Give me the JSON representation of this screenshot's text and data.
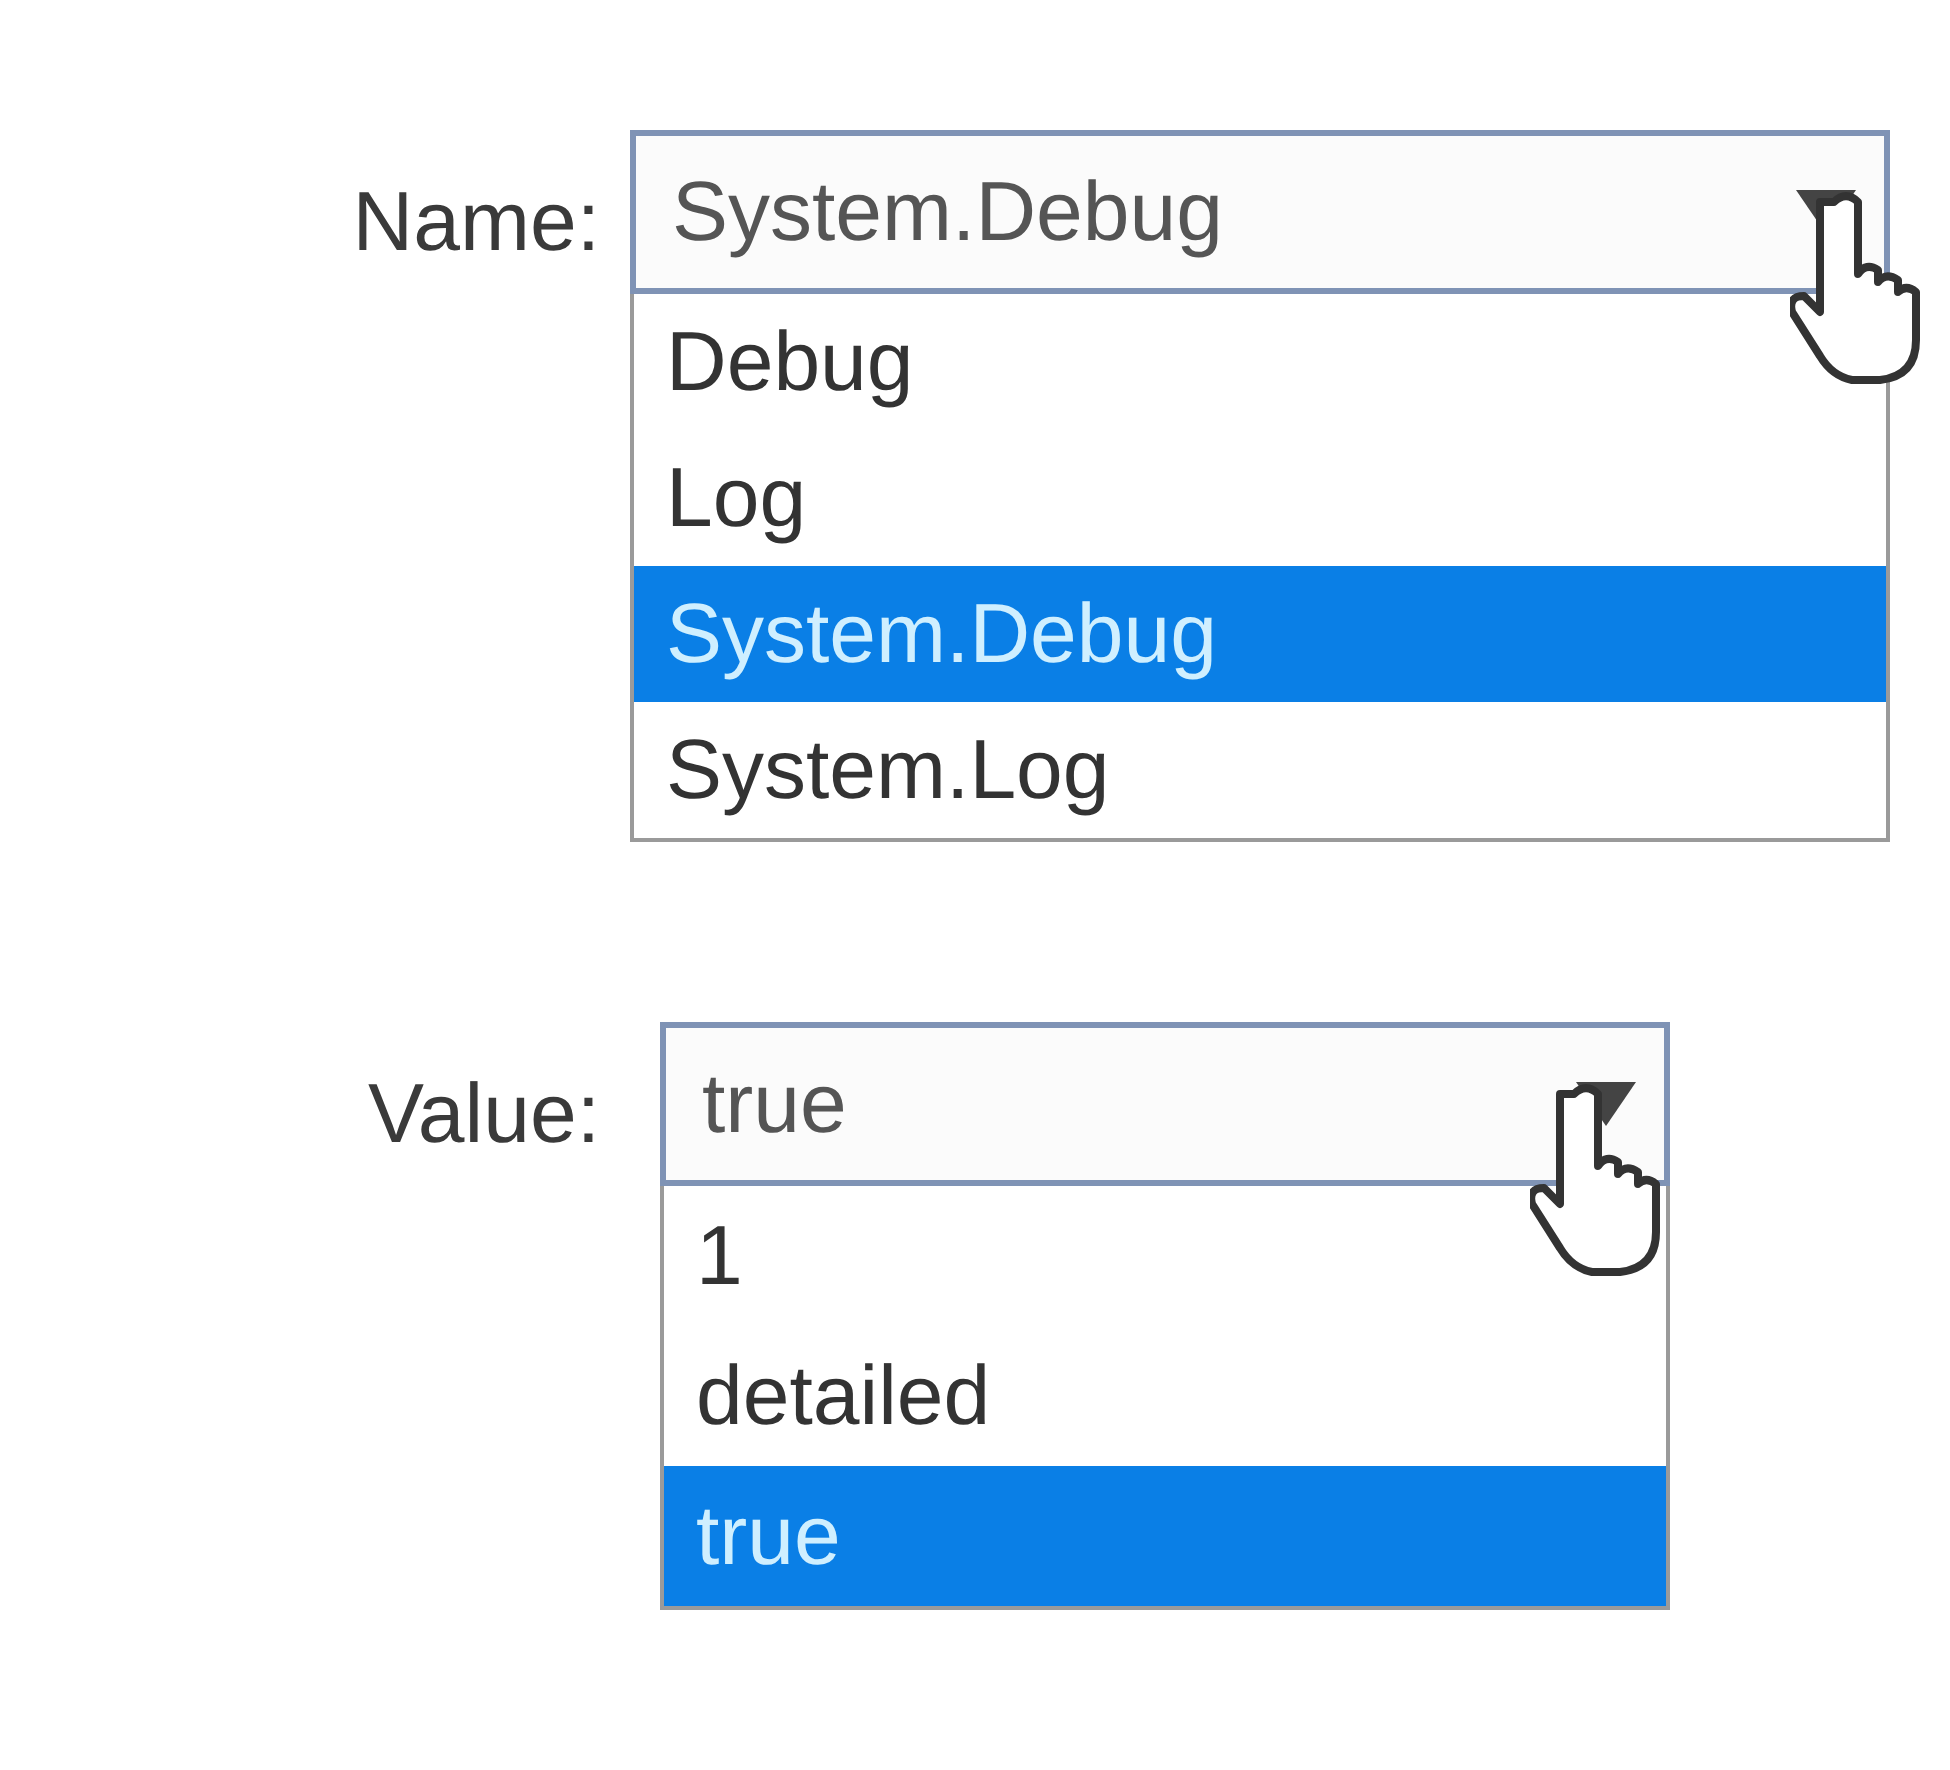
{
  "fields": [
    {
      "label": "Name:",
      "value": "System.Debug",
      "open": true,
      "options": [
        {
          "label": "Debug",
          "selected": false
        },
        {
          "label": "Log",
          "selected": false
        },
        {
          "label": "System.Debug",
          "selected": true
        },
        {
          "label": "System.Log",
          "selected": false
        }
      ]
    },
    {
      "label": "Value:",
      "value": "true",
      "open": true,
      "options": [
        {
          "label": "1",
          "selected": false
        },
        {
          "label": "detailed",
          "selected": false
        },
        {
          "label": "true",
          "selected": true
        }
      ]
    }
  ]
}
